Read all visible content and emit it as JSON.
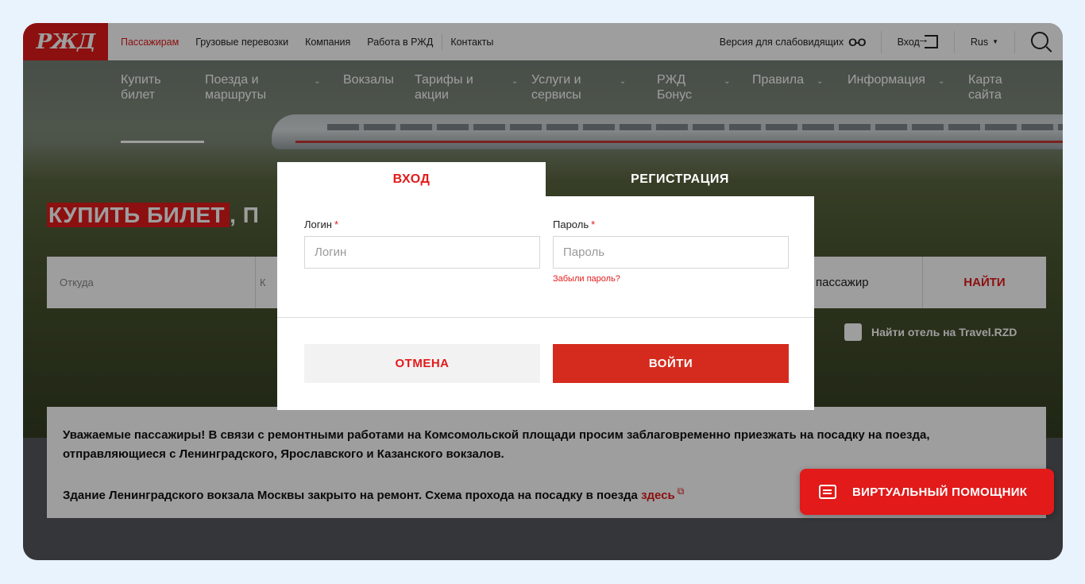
{
  "topbar": {
    "logo": "РЖД",
    "links": [
      {
        "label": "Пассажирам",
        "active": true
      },
      {
        "label": "Грузовые перевозки",
        "active": false
      },
      {
        "label": "Компания",
        "active": false
      },
      {
        "label": "Работа в РЖД",
        "active": false
      },
      {
        "label": "Контакты",
        "active": false
      }
    ],
    "accessibility": "Версия для слабовидящих",
    "accessibility_icon": "glasses-icon",
    "login": "Вход",
    "login_icon": "enter-icon",
    "language": "Rus",
    "search_icon": "search-icon"
  },
  "mainnav": {
    "items": [
      {
        "label": "Купить\nбилет",
        "chevron": false
      },
      {
        "label": "Поезда и\nмаршруты",
        "chevron": true
      },
      {
        "label": "Вокзалы",
        "chevron": false
      },
      {
        "label": "Тарифы и\nакции",
        "chevron": true
      },
      {
        "label": "Услуги и\nсервисы",
        "chevron": true
      },
      {
        "label": "РЖД\nБонус",
        "chevron": true
      },
      {
        "label": "Правила",
        "chevron": true
      },
      {
        "label": "Информация",
        "chevron": true
      },
      {
        "label": "Карта\nсайта",
        "chevron": false
      }
    ]
  },
  "hero": {
    "title_highlight": "КУПИТЬ БИЛЕТ",
    "title_rest": ", П"
  },
  "search": {
    "from": "Откуда",
    "to": "К",
    "passenger": "пассажир",
    "find": "НАЙТИ",
    "hotel": "Найти отель на Travel.RZD"
  },
  "notice": {
    "line1": "Уважаемые пассажиры! В связи с ремонтными работами на Комсомольской площади просим заблаговременно приезжать на посадку на поезда, отправляющиеся с Ленинградского, Ярославского и Казанского вокзалов.",
    "line2": "Здание Ленинградского вокзала Москвы закрыто на ремонт. Схема прохода на посадку в поезда ",
    "link": "здесь"
  },
  "assistant": {
    "label": "ВИРТУАЛЬНЫЙ ПОМОЩНИК",
    "icon": "chat-icon"
  },
  "modal": {
    "tabs": {
      "login": "ВХОД",
      "register": "РЕГИСТРАЦИЯ"
    },
    "login_label": "Логин",
    "login_placeholder": "Логин",
    "password_label": "Пароль",
    "password_placeholder": "Пароль",
    "required_mark": "*",
    "forgot": "Забыли пароль?",
    "cancel": "ОТМЕНА",
    "submit": "ВОЙТИ"
  },
  "colors": {
    "brand": "#e21a1a",
    "page_bg": "#e9f3fd"
  }
}
